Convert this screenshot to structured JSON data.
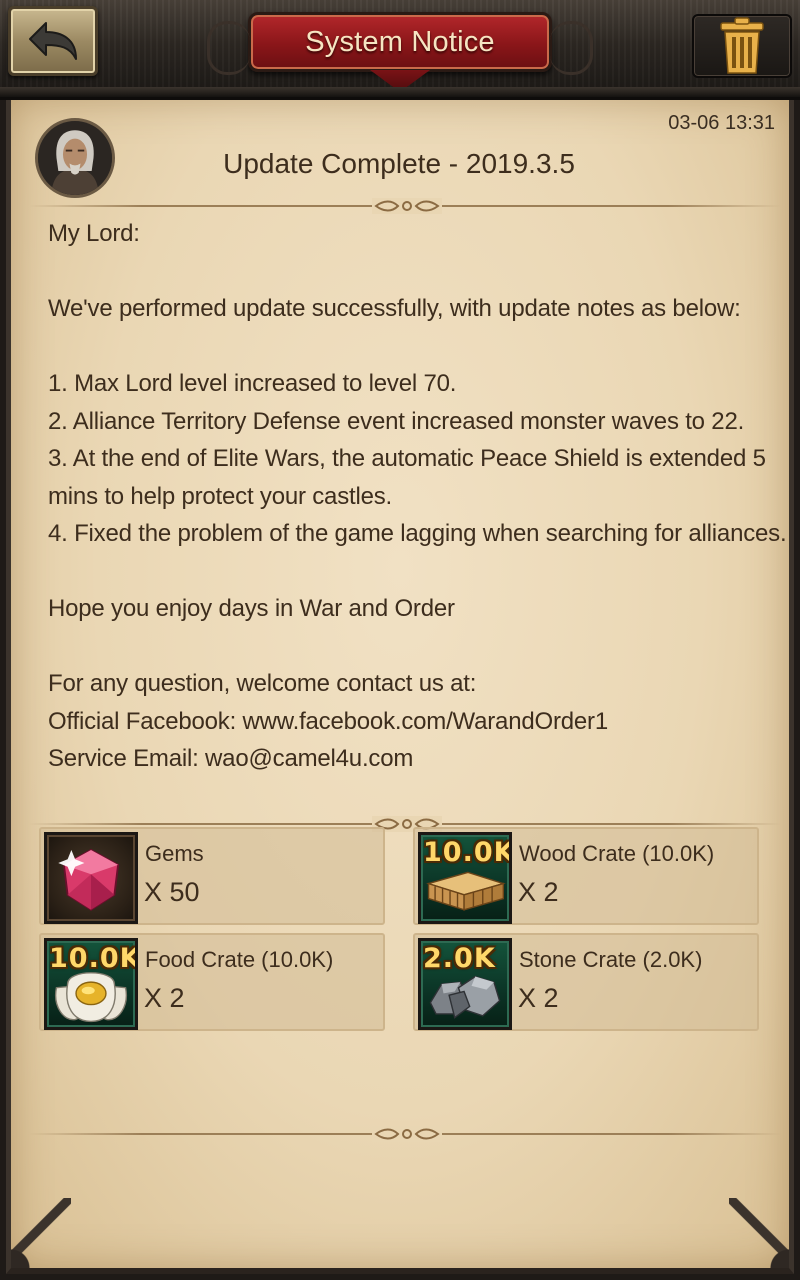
{
  "header": {
    "title": "System Notice",
    "back_icon": "back-arrow-icon",
    "trash_icon": "trash-icon"
  },
  "mail": {
    "timestamp": "03-06 13:31",
    "title": "Update Complete - 2019.3.5",
    "greeting": "My Lord:",
    "intro": "We've performed update successfully, with update notes as below:",
    "notes": [
      "1. Max Lord level increased to level 70.",
      "2. Alliance Territory Defense event increased monster waves to 22.",
      "3. At the end of Elite Wars, the automatic Peace Shield is extended 5 mins to help protect your castles.",
      "4. Fixed the problem of the game lagging when searching for alliances."
    ],
    "closing": "Hope you enjoy days in War and Order",
    "contact_intro": "For any question, welcome contact us at:",
    "facebook_label": "Official Facebook: ",
    "facebook_value": "www.facebook.com/WarandOrder1",
    "email_label": "Service Email: ",
    "email_value": "wao@camel4u.com"
  },
  "rewards": [
    {
      "name": "Gems",
      "qty": "X 50",
      "badge": "",
      "icon": "gem-icon"
    },
    {
      "name": "Wood Crate (10.0K)",
      "qty": "X 2",
      "badge": "10.0K",
      "icon": "wood-crate-icon"
    },
    {
      "name": "Food Crate (10.0K)",
      "qty": "X 2",
      "badge": "10.0K",
      "icon": "food-crate-icon"
    },
    {
      "name": "Stone Crate (2.0K)",
      "qty": "X 2",
      "badge": "2.0K",
      "icon": "stone-crate-icon"
    }
  ],
  "colors": {
    "parchment": "#ead7b4",
    "text": "#3d2d1d",
    "title_plate": "#8a1619",
    "badge_text": "#ffd86a"
  }
}
